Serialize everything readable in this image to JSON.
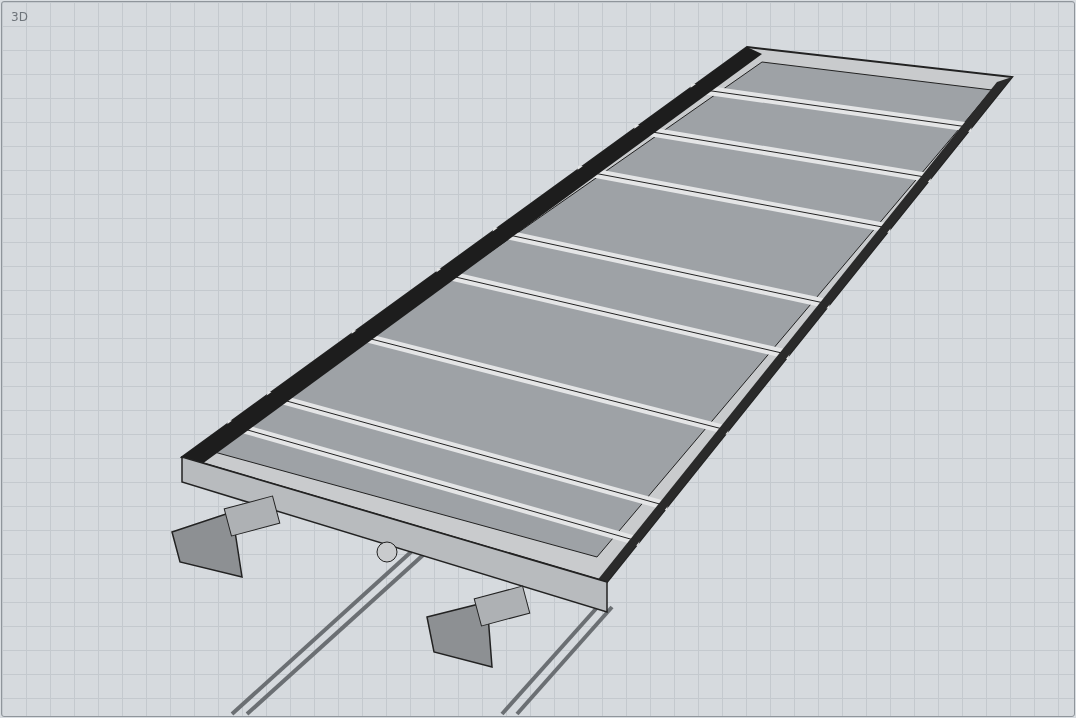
{
  "viewport": {
    "title": "3D"
  }
}
